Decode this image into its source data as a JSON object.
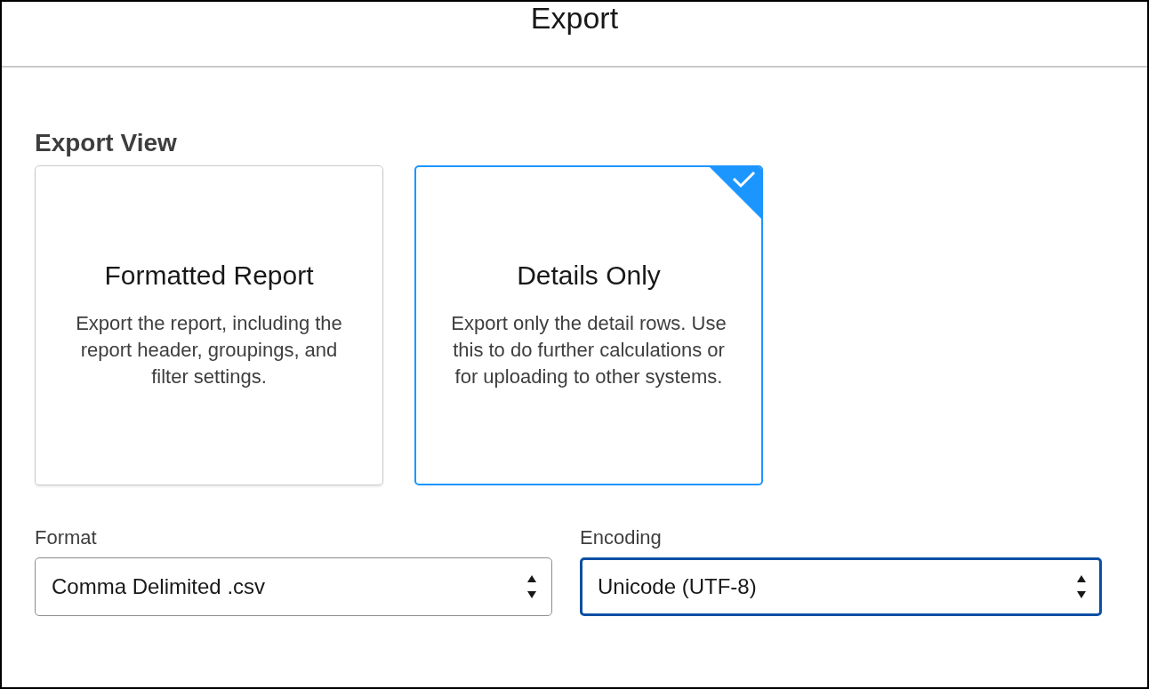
{
  "dialog": {
    "title": "Export"
  },
  "export_view": {
    "heading": "Export View",
    "options": [
      {
        "title": "Formatted Report",
        "description": "Export the report, including the report header, groupings, and filter settings.",
        "selected": false
      },
      {
        "title": "Details Only",
        "description": "Export only the detail rows. Use this to do further calculations or for uploading to other systems.",
        "selected": true
      }
    ]
  },
  "fields": [
    {
      "label": "Format",
      "value": "Comma Delimited .csv",
      "focused": false
    },
    {
      "label": "Encoding",
      "value": "Unicode (UTF-8)",
      "focused": true
    }
  ]
}
